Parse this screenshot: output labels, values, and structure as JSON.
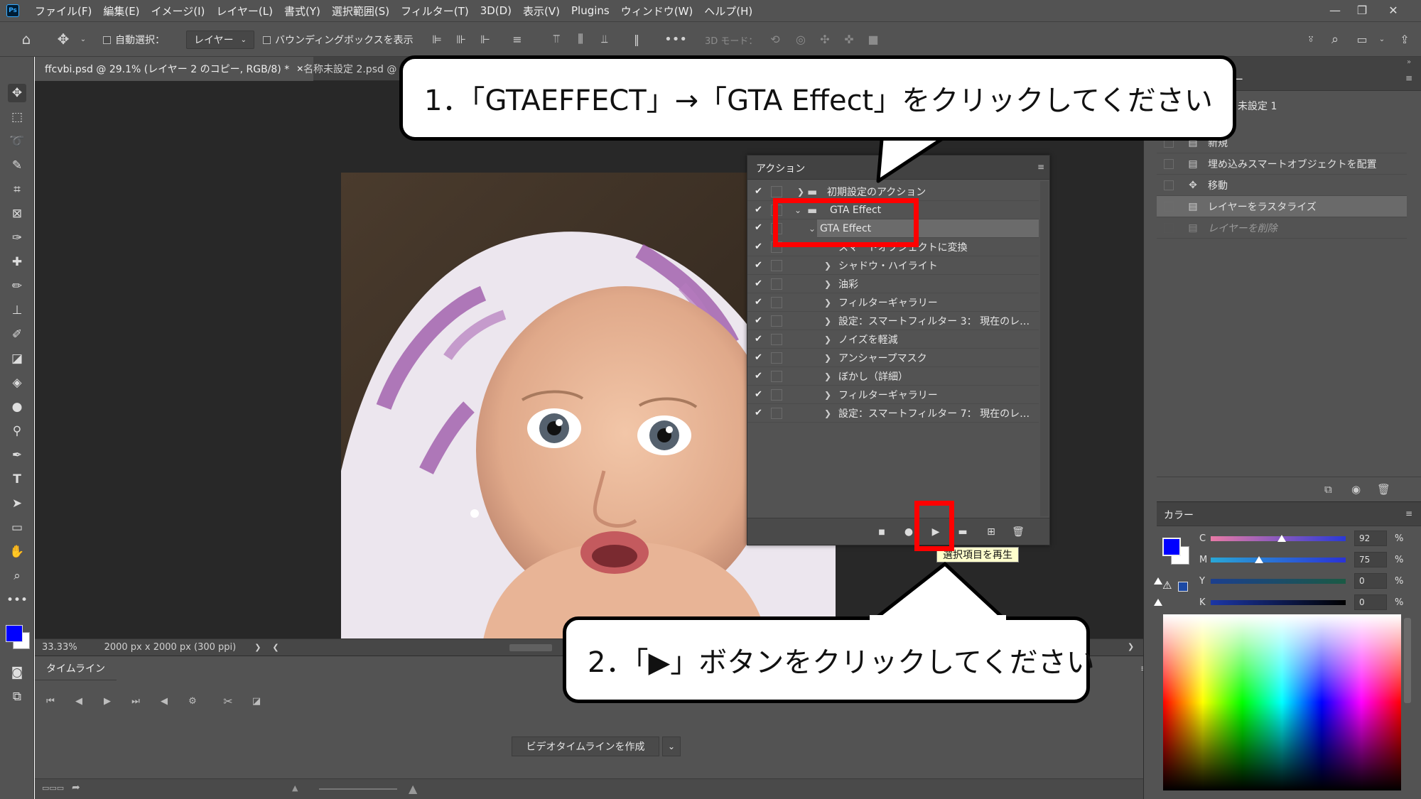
{
  "menu": {
    "app_icon": "Ps",
    "items": [
      "ファイル(F)",
      "編集(E)",
      "イメージ(I)",
      "レイヤー(L)",
      "書式(Y)",
      "選択範囲(S)",
      "フィルター(T)",
      "3D(D)",
      "表示(V)",
      "Plugins",
      "ウィンドウ(W)",
      "ヘルプ(H)"
    ]
  },
  "options": {
    "auto_select": "自動選択：",
    "layer_dropdown": "レイヤー",
    "bounding_box": "バウンディングボックスを表示",
    "mode_3d": "3D モード："
  },
  "tabs": [
    {
      "label": "ffcvbi.psd @ 29.1% (レイヤー 2 のコピー, RGB/8) *"
    },
    {
      "label": "名称未設定 2.psd @"
    }
  ],
  "status": {
    "zoom": "33.33%",
    "doc_size": "2000 px x 2000 px (300 ppi)"
  },
  "timeline": {
    "tab": "タイムライン",
    "create_button": "ビデオタイムラインを作成"
  },
  "history": {
    "tab": "ー",
    "snapshot": "未設定 1",
    "items": [
      {
        "label": "新規"
      },
      {
        "label": "埋め込みスマートオブジェクトを配置"
      },
      {
        "label": "移動"
      },
      {
        "label": "レイヤーをラスタライズ"
      },
      {
        "label": "レイヤーを削除"
      }
    ]
  },
  "color_panel": {
    "tab": "カラー",
    "channels": [
      {
        "name": "C",
        "value": "92",
        "pct": "%"
      },
      {
        "name": "M",
        "value": "75",
        "pct": "%"
      },
      {
        "name": "Y",
        "value": "0",
        "pct": "%"
      },
      {
        "name": "K",
        "value": "0",
        "pct": "%"
      }
    ],
    "fg_color": "#0000ff",
    "bg_color": "#ffffff"
  },
  "actions": {
    "tab": "アクション",
    "rows": [
      {
        "label": "初期設定のアクション"
      },
      {
        "label": "GTA Effect"
      },
      {
        "label": "GTA Effect"
      },
      {
        "label": "スマートオブジェクトに変換"
      },
      {
        "label": "シャドウ・ハイライト"
      },
      {
        "label": "油彩"
      },
      {
        "label": "フィルターギャラリー"
      },
      {
        "label": "設定：スマートフィルター 3： 現在のレイ..."
      },
      {
        "label": "ノイズを軽減"
      },
      {
        "label": "アンシャープマスク"
      },
      {
        "label": "ぼかし（詳細）"
      },
      {
        "label": "フィルターギャラリー"
      },
      {
        "label": "設定：スマートフィルター 7： 現在のレイ..."
      }
    ],
    "check": "✔",
    "tooltip": "選択項目を再生"
  },
  "callouts": {
    "step1": "1．「GTAEFFECT」→「GTA Effect」をクリックしてください",
    "step2": "2．「▶」ボタンをクリックしてください"
  },
  "colors": {
    "highlight": "#ff0000",
    "ui_bg": "#535353",
    "canvas_bg": "#282828"
  }
}
